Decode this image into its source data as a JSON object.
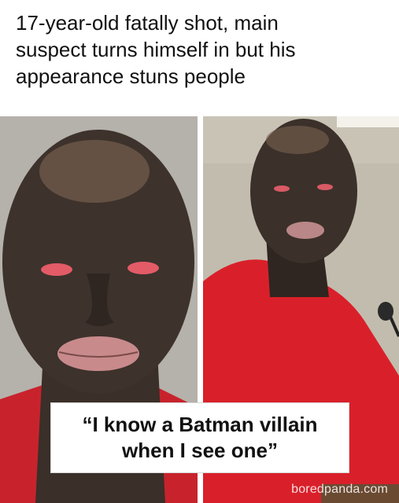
{
  "headline": "17-year-old fatally shot, main\nsuspect turns himself in but his\nappearance stuns people",
  "photos": {
    "left": {
      "subject": "mugshot-face"
    },
    "right": {
      "subject": "man-in-red-sweater-at-podium"
    }
  },
  "caption": "“I know a Batman villain\nwhen I see one”",
  "watermark": "boredpanda.com",
  "colors": {
    "background": "#ffffff",
    "text": "#111111",
    "sweater_red": "#d9202a",
    "skin_dark": "#3b302a"
  }
}
